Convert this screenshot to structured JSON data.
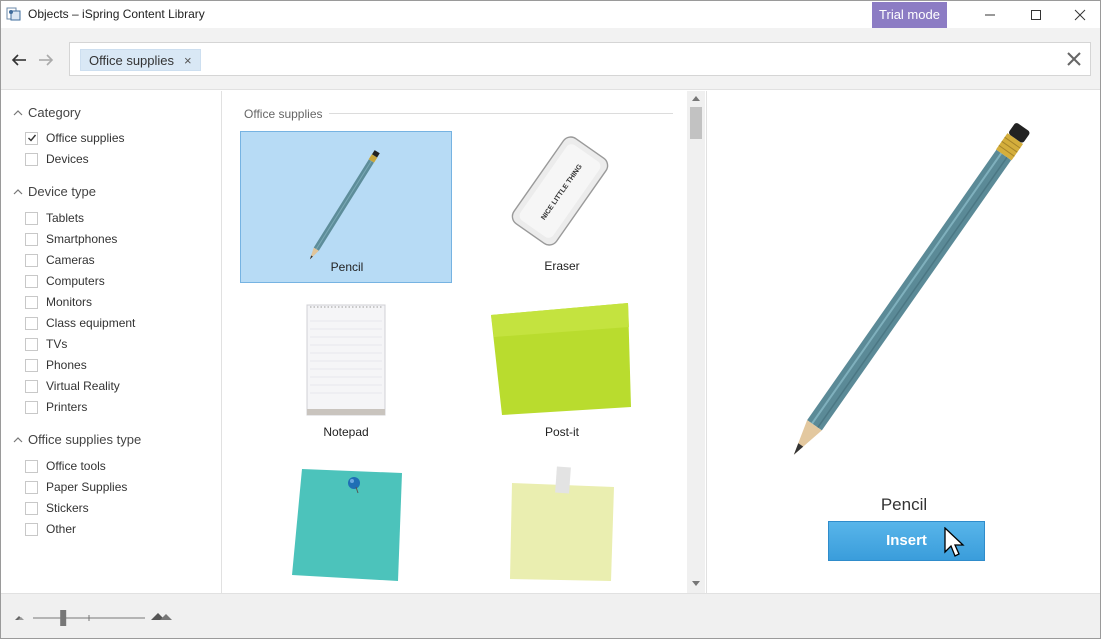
{
  "window": {
    "title": "Objects – iSpring Content Library",
    "trial_badge": "Trial mode",
    "accent_color": "#8c7cc4"
  },
  "toolbar": {
    "search_tag": "Office supplies",
    "search_value": "",
    "search_placeholder": ""
  },
  "sidebar": {
    "groups": [
      {
        "title": "Category",
        "items": [
          {
            "label": "Office supplies",
            "checked": true
          },
          {
            "label": "Devices",
            "checked": false
          }
        ]
      },
      {
        "title": "Device type",
        "items": [
          {
            "label": "Tablets",
            "checked": false
          },
          {
            "label": "Smartphones",
            "checked": false
          },
          {
            "label": "Cameras",
            "checked": false
          },
          {
            "label": "Computers",
            "checked": false
          },
          {
            "label": "Monitors",
            "checked": false
          },
          {
            "label": "Class equipment",
            "checked": false
          },
          {
            "label": "TVs",
            "checked": false
          },
          {
            "label": "Phones",
            "checked": false
          },
          {
            "label": "Virtual Reality",
            "checked": false
          },
          {
            "label": "Printers",
            "checked": false
          }
        ]
      },
      {
        "title": "Office supplies type",
        "items": [
          {
            "label": "Office tools",
            "checked": false
          },
          {
            "label": "Paper Supplies",
            "checked": false
          },
          {
            "label": "Stickers",
            "checked": false
          },
          {
            "label": "Other",
            "checked": false
          }
        ]
      }
    ]
  },
  "grid": {
    "section_title": "Office supplies",
    "items": [
      {
        "label": "Pencil",
        "selected": true
      },
      {
        "label": "Eraser",
        "selected": false
      },
      {
        "label": "Notepad",
        "selected": false
      },
      {
        "label": "Post-it",
        "selected": false
      },
      {
        "label": "",
        "selected": false
      },
      {
        "label": "",
        "selected": false
      }
    ],
    "eraser_print": "NICE LITTLE THING"
  },
  "preview": {
    "name": "Pencil",
    "insert_label": "Insert"
  },
  "zoom": {
    "level": 0.27
  }
}
